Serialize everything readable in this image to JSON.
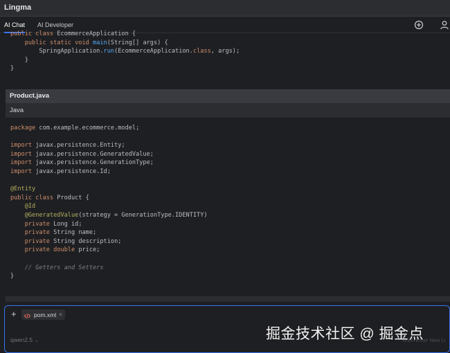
{
  "window": {
    "title": "Lingma"
  },
  "tabs": [
    {
      "label": "AI Chat",
      "active": true
    },
    {
      "label": "AI Developer",
      "active": false
    }
  ],
  "toolbar": {
    "icons": [
      "plus-circle-icon",
      "user-icon"
    ]
  },
  "code_top": {
    "lines": [
      [
        [
          "kw",
          "public class "
        ],
        [
          "",
          "EcommerceApplication {"
        ]
      ],
      [
        [
          "",
          "    "
        ],
        [
          "kw",
          "public static void "
        ],
        [
          "fn",
          "main"
        ],
        [
          "",
          "(String[] args) {"
        ]
      ],
      [
        [
          "",
          "        SpringApplication."
        ],
        [
          "fn",
          "run"
        ],
        [
          "",
          "(EcommerceApplication."
        ],
        [
          "kw",
          "class"
        ],
        [
          "",
          ", args);"
        ]
      ],
      [
        [
          "",
          "    }"
        ]
      ],
      [
        [
          "",
          "}"
        ]
      ]
    ]
  },
  "file_block": {
    "filename": "Product.java",
    "language": "Java",
    "lines": [
      [
        [
          "kw",
          "package "
        ],
        [
          "",
          "com.example.ecommerce.model;"
        ]
      ],
      [],
      [
        [
          "kw",
          "import "
        ],
        [
          "",
          "javax.persistence.Entity;"
        ]
      ],
      [
        [
          "kw",
          "import "
        ],
        [
          "",
          "javax.persistence.GeneratedValue;"
        ]
      ],
      [
        [
          "kw",
          "import "
        ],
        [
          "",
          "javax.persistence.GenerationType;"
        ]
      ],
      [
        [
          "kw",
          "import "
        ],
        [
          "",
          "javax.persistence.Id;"
        ]
      ],
      [],
      [
        [
          "an",
          "@Entity"
        ]
      ],
      [
        [
          "kw",
          "public class "
        ],
        [
          "",
          "Product {"
        ]
      ],
      [
        [
          "",
          "    "
        ],
        [
          "an",
          "@Id"
        ]
      ],
      [
        [
          "",
          "    "
        ],
        [
          "an",
          "@GeneratedValue"
        ],
        [
          "",
          "(strategy = GenerationType.IDENTITY)"
        ]
      ],
      [
        [
          "",
          "    "
        ],
        [
          "kw",
          "private "
        ],
        [
          "",
          "Long id;"
        ]
      ],
      [
        [
          "",
          "    "
        ],
        [
          "kw",
          "private "
        ],
        [
          "",
          "String name;"
        ]
      ],
      [
        [
          "",
          "    "
        ],
        [
          "kw",
          "private "
        ],
        [
          "",
          "String description;"
        ]
      ],
      [
        [
          "",
          "    "
        ],
        [
          "kw",
          "private double "
        ],
        [
          "",
          "price;"
        ]
      ],
      [],
      [
        [
          "",
          "    "
        ],
        [
          "cm",
          "// Getters and Setters"
        ]
      ],
      [
        [
          "",
          "}"
        ]
      ]
    ]
  },
  "input": {
    "add_label": "+",
    "file_chip": {
      "name": "pom.xml",
      "close": "×",
      "icon": "code-file-icon"
    },
    "model": "qwen2.5",
    "hint": "Shift+Enter New Li"
  },
  "watermark": "掘金技术社区 @ 掘金点",
  "colors": {
    "accent": "#3574f0",
    "keyword": "#cf8e6d",
    "function": "#56a8f5",
    "annotation": "#b3ae60",
    "comment": "#7a7e85"
  }
}
